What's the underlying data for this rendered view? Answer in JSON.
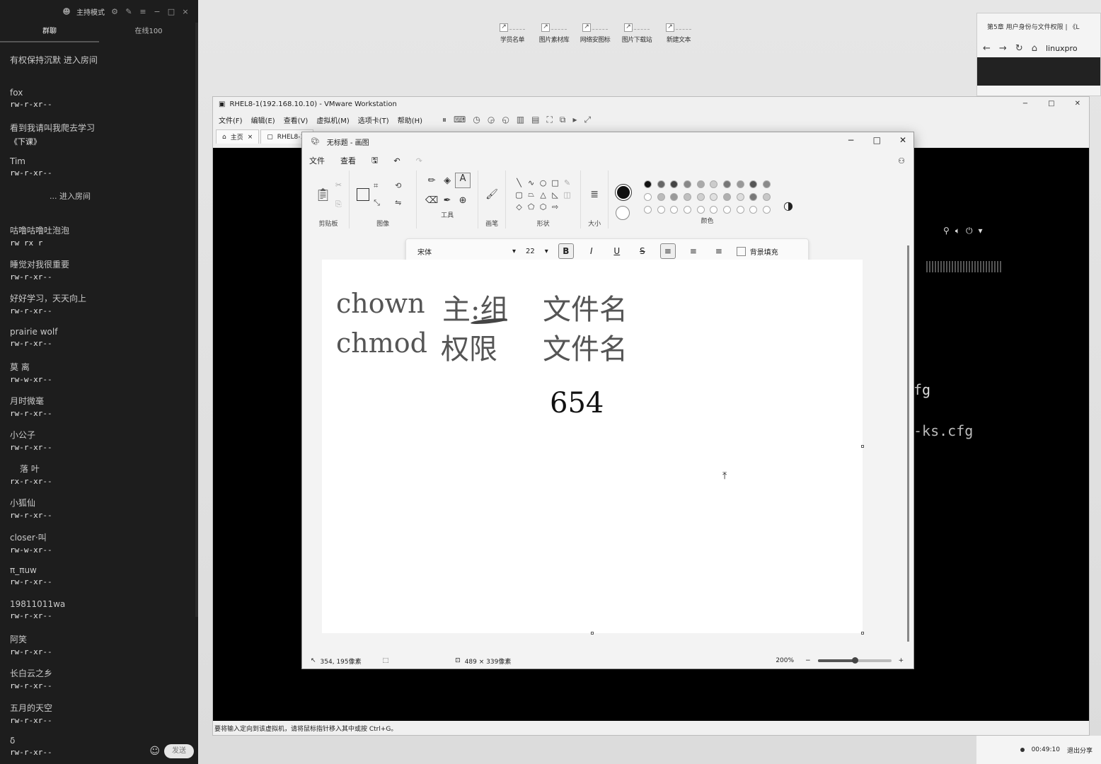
{
  "chat": {
    "mode_label": "主持模式",
    "tab_chat": "群聊",
    "tab_online": "在线100",
    "messages": [
      {
        "name": "有权保持沉默 进入房间",
        "text": ""
      },
      {
        "name": "fox",
        "text": "rw-r-xr--"
      },
      {
        "name": "看到我请叫我爬去学习",
        "text": "《下课》"
      },
      {
        "name": "Tim",
        "text": "rw-r-xr--"
      },
      {
        "name": "... 进入房间",
        "text": ""
      },
      {
        "name": "咕噜咕噜吐泡泡",
        "text": "rw rx r"
      },
      {
        "name": "睡觉对我很重要",
        "text": "rw-r-xr--"
      },
      {
        "name": "好好学习，天天向上",
        "text": "rw-r-xr--"
      },
      {
        "name": "prairie wolf",
        "text": "rw-r-xr--"
      },
      {
        "name": "莫 离",
        "text": "rw-w-xr--"
      },
      {
        "name": "月时微毫",
        "text": "rw-r-xr--"
      },
      {
        "name": "小公子",
        "text": "rw-r-xr--"
      },
      {
        "name": "落   叶",
        "text": "rx-r-xr--"
      },
      {
        "name": "小狐仙",
        "text": "rw-r-xr--"
      },
      {
        "name": "closer·叫",
        "text": "rw-w-xr--"
      },
      {
        "name": "π_πuw",
        "text": "rw-r-xr--"
      },
      {
        "name": "19811011wa",
        "text": "rw-r-xr--"
      },
      {
        "name": "阿笑",
        "text": "rw-r-xr--"
      },
      {
        "name": "长白云之乡",
        "text": "rw-r-xr--"
      },
      {
        "name": "五月的天空",
        "text": "rw-r-xr--"
      },
      {
        "name": "δ",
        "text": "rw-r-xr--"
      }
    ],
    "send_label": "发送"
  },
  "desktop": {
    "shortcuts": [
      "学员名单",
      "图片素材库",
      "网络安图标",
      "图片下载站",
      "新建文本"
    ]
  },
  "browser": {
    "tab_title": "第5章 用户身份与文件权限 | 《L",
    "url": "linuxpro"
  },
  "vmware": {
    "title": "RHEL8-1(192.168.10.10) - VMware Workstation",
    "menus": [
      "文件(F)",
      "编辑(E)",
      "查看(V)",
      "虚拟机(M)",
      "选项卡(T)",
      "帮助(H)"
    ],
    "tab_home": "主页",
    "tab_vm": "RHEL8-1(",
    "guest_line1": "fg",
    "guest_line2": "-ks.cfg",
    "status_text": "要将输入定向到该虚拟机，请将鼠标指针移入其中或按 Ctrl+G。"
  },
  "paint": {
    "title": "无标题 - 画图",
    "menu_file": "文件",
    "menu_view": "查看",
    "groups": {
      "clipboard": "剪贴板",
      "image": "图像",
      "tools": "工具",
      "brushes": "画笔",
      "shapes": "形状",
      "size": "大小",
      "colors": "颜色"
    },
    "font_name": "宋体",
    "font_size": "22",
    "bg_fill_label": "背景填充",
    "canvas_line1_cmd": "chown",
    "canvas_line1_owner": "主:组",
    "canvas_line1_file": "文件名",
    "canvas_line2_cmd": "chmod",
    "canvas_line2_perm": "权限",
    "canvas_line2_file": "文件名",
    "canvas_number": "654",
    "cursor_pos": "354, 195像素",
    "selection_size": "489 × 339像素",
    "zoom": "200%",
    "zoom_fraction": 0.5
  },
  "taskbar": {
    "time": "00:49:10",
    "exit_share": "退出分享"
  },
  "colors": {
    "swatches_row1": [
      "#111111",
      "#666666",
      "#444444",
      "#888888",
      "#aaaaaa",
      "#cccccc",
      "#777777",
      "#999999",
      "#555555",
      "#8a8a8a"
    ],
    "swatches_row2": [
      "#ffffff",
      "#bbbbbb",
      "#999999",
      "#c0c0c0",
      "#d0d0d0",
      "#e0e0e0",
      "#b0b0b0",
      "#dddddd",
      "#777777",
      "#c8c8c8"
    ]
  }
}
